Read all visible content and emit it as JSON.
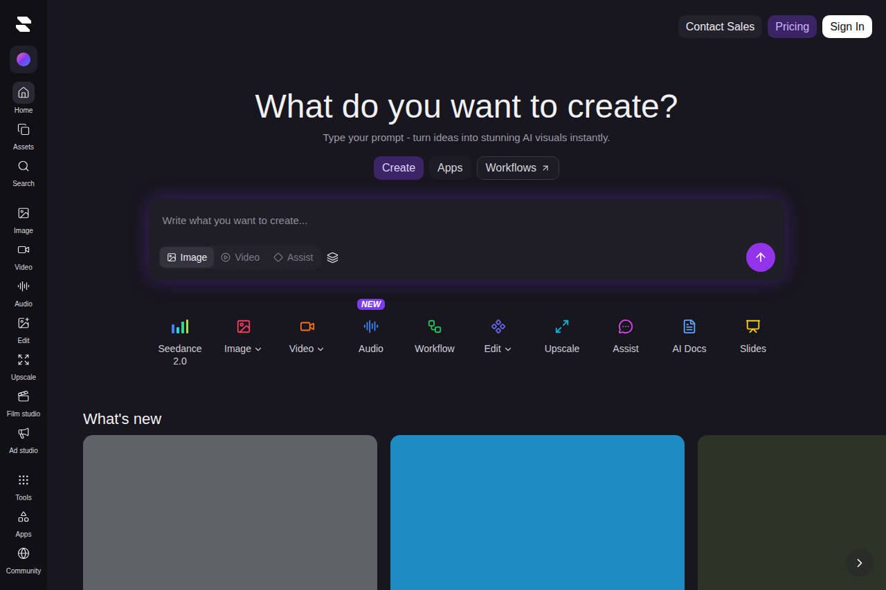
{
  "sidebar": {
    "groups": [
      [
        {
          "label": "Home",
          "selected": true
        },
        {
          "label": "Assets",
          "selected": false
        },
        {
          "label": "Search",
          "selected": false
        }
      ],
      [
        {
          "label": "Image",
          "selected": false
        },
        {
          "label": "Video",
          "selected": false
        },
        {
          "label": "Audio",
          "selected": false
        },
        {
          "label": "Edit",
          "selected": false
        },
        {
          "label": "Upscale",
          "selected": false
        },
        {
          "label": "Film studio",
          "selected": false
        },
        {
          "label": "Ad studio",
          "selected": false
        }
      ],
      [
        {
          "label": "Tools",
          "selected": false
        },
        {
          "label": "Apps",
          "selected": false
        },
        {
          "label": "Community",
          "selected": false
        }
      ]
    ]
  },
  "header": {
    "buttons": [
      {
        "label": "Contact Sales",
        "kind": "dark"
      },
      {
        "label": "Pricing",
        "kind": "accent"
      },
      {
        "label": "Sign In",
        "kind": "light"
      }
    ]
  },
  "hero": {
    "title": "What do you want to create?",
    "subtitle": "Type your prompt - turn ideas into stunning AI visuals instantly."
  },
  "tabs": [
    {
      "label": "Create",
      "selected": true,
      "external": false
    },
    {
      "label": "Apps",
      "selected": false,
      "external": false
    },
    {
      "label": "Workflows",
      "selected": false,
      "external": true
    }
  ],
  "prompt": {
    "placeholder": "Write what you want to create...",
    "modes": [
      {
        "label": "Image",
        "selected": true
      },
      {
        "label": "Video",
        "selected": false
      },
      {
        "label": "Assist",
        "selected": false
      }
    ]
  },
  "tools": [
    {
      "label": "Seedance 2.0",
      "dropdown": false,
      "badge": "",
      "color": "#3b82f6"
    },
    {
      "label": "Image",
      "dropdown": true,
      "badge": "",
      "color": "#f43f5e"
    },
    {
      "label": "Video",
      "dropdown": true,
      "badge": "",
      "color": "#f97316"
    },
    {
      "label": "Audio",
      "dropdown": false,
      "badge": "NEW",
      "color": "#3b82f6"
    },
    {
      "label": "Workflow",
      "dropdown": false,
      "badge": "",
      "color": "#22c55e"
    },
    {
      "label": "Edit",
      "dropdown": true,
      "badge": "",
      "color": "#6366f1"
    },
    {
      "label": "Upscale",
      "dropdown": false,
      "badge": "",
      "color": "#06b6d4"
    },
    {
      "label": "Assist",
      "dropdown": false,
      "badge": "",
      "color": "#d946ef"
    },
    {
      "label": "AI Docs",
      "dropdown": false,
      "badge": "",
      "color": "#60a5fa"
    },
    {
      "label": "Slides",
      "dropdown": false,
      "badge": "",
      "color": "#facc15"
    }
  ],
  "whats_new": {
    "title": "What's new",
    "cards": [
      {
        "color": "#5f6366"
      },
      {
        "color": "#1e8cc3"
      },
      {
        "color": "#2c3327"
      }
    ]
  }
}
